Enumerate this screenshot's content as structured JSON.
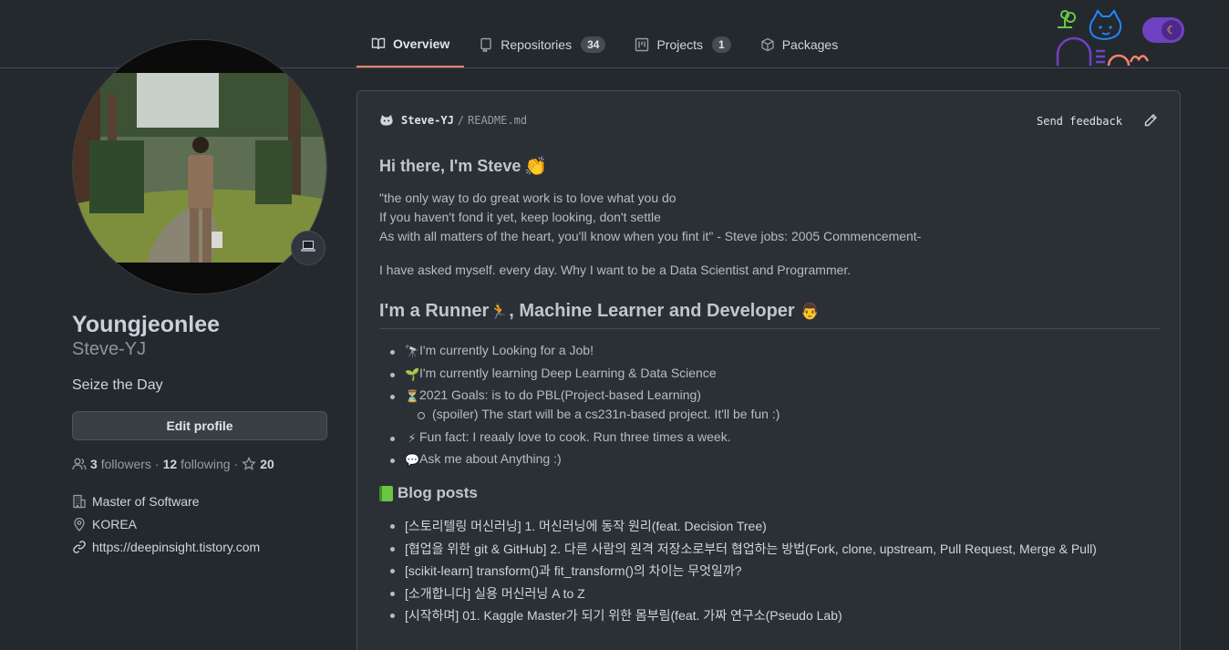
{
  "nav": {
    "tabs": [
      {
        "label": "Overview",
        "icon": "book-icon",
        "active": true
      },
      {
        "label": "Repositories",
        "icon": "repo-icon",
        "count": "34"
      },
      {
        "label": "Projects",
        "icon": "project-icon",
        "count": "1"
      },
      {
        "label": "Packages",
        "icon": "package-icon"
      }
    ],
    "theme_toggle_icon": "moon-icon"
  },
  "profile": {
    "fullname": "Youngjeonlee",
    "username": "Steve-YJ",
    "bio": "Seize the Day",
    "edit_button": "Edit profile",
    "followers_count": "3",
    "followers_label": "followers",
    "dot1": "·",
    "following_count": "12",
    "following_label": "following",
    "dot2": "·",
    "stars": "20",
    "organization": "Master of Software",
    "location": "KOREA",
    "website": "https://deepinsight.tistory.com"
  },
  "readme": {
    "owner": "Steve-YJ",
    "separator": "/",
    "filename": "README.md",
    "send_feedback": "Send feedback",
    "greeting": "Hi there, I'm Steve",
    "quote_line1": "\"the only way to do great work is to love what you do",
    "quote_line2": "If you haven't fond it yet, keep looking, don't settle",
    "quote_line3": "As with all matters of the heart, you'll know when you fint it\" - Steve jobs: 2005 Commencement-",
    "question": "I have asked myself. every day. Why I want to be a Data Scientist and Programmer.",
    "heading_runner": "I'm a Runner",
    "heading_rest": ", Machine Learner and Developer",
    "items": [
      {
        "emoji": "🔭",
        "text": "I'm currently Looking for a Job!"
      },
      {
        "emoji": "🌱",
        "text": "I'm currently learning Deep Learning & Data Science"
      },
      {
        "emoji": "⏳",
        "text": "2021 Goals: is to do PBL(Project-based Learning)"
      },
      {
        "emoji": "⚡",
        "text": "Fun fact: I reaaly love to cook. Run three times a week."
      },
      {
        "emoji": "💬",
        "text": "Ask me about Anything :)"
      }
    ],
    "sub_item": "(spoiler) The start will be a cs231n-based project. It'll be fun :)",
    "blog_heading": "Blog posts",
    "blog_posts": [
      "[스토리텔링 머신러닝] 1. 머신러닝에 동작 원리(feat. Decision Tree)",
      "[협업을 위한 git & GitHub] 2. 다른 사람의 원격 저장소로부터 협업하는 방법(Fork, clone, upstream, Pull Request, Merge & Pull)",
      "[scikit-learn] transform()과 fit_transform()의 차이는 무엇일까?",
      "[소개합니다] 실용 머신러닝 A to Z",
      "[시작하며] 01. Kaggle Master가 되기 위한 몸부림(feat. 가짜 연구소(Pseudo Lab)"
    ]
  }
}
